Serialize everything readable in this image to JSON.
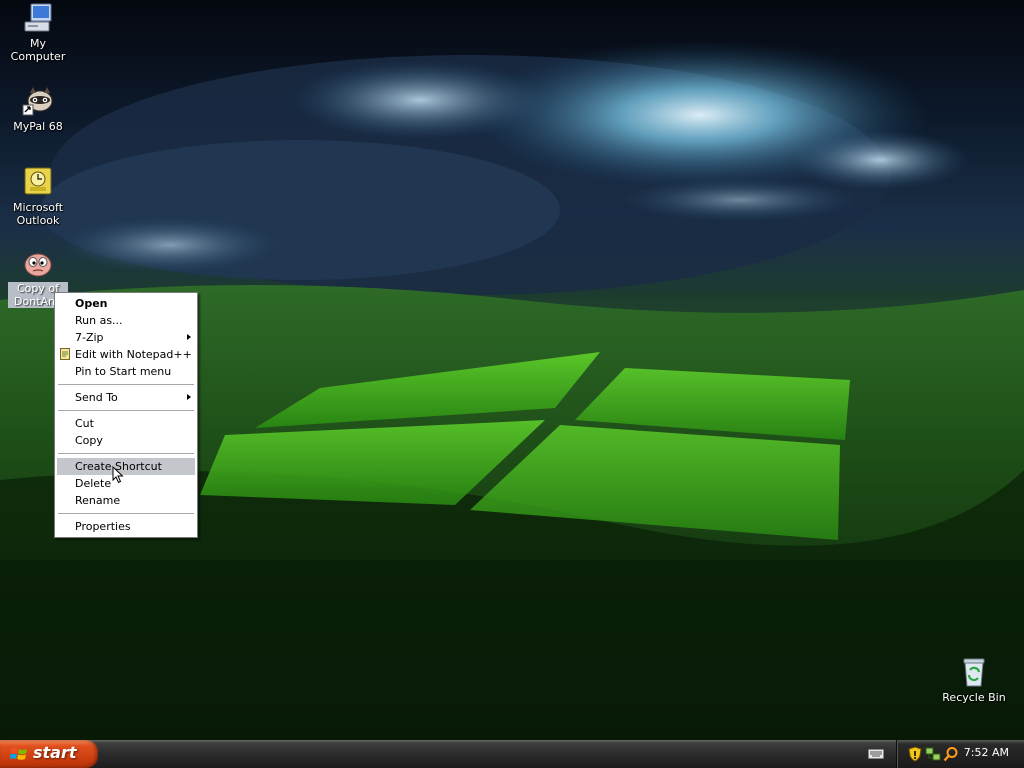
{
  "desktop": {
    "icons": [
      {
        "label": "My Computer",
        "icon": "computer-icon"
      },
      {
        "label": "MyPal 68",
        "icon": "raccoon-browser-icon"
      },
      {
        "label": "Microsoft Outlook",
        "icon": "outlook-icon"
      },
      {
        "label": "Copy of DontAng",
        "icon": "dontang-icon"
      },
      {
        "label": "Recycle Bin",
        "icon": "recycle-bin-icon"
      }
    ]
  },
  "context_menu": {
    "open": "Open",
    "run_as": "Run as...",
    "seven_zip": "7-Zip",
    "edit_notepad": "Edit with Notepad++",
    "pin_start": "Pin to Start menu",
    "send_to": "Send To",
    "cut": "Cut",
    "copy": "Copy",
    "create_shortcut": "Create Shortcut",
    "delete": "Delete",
    "rename": "Rename",
    "properties": "Properties"
  },
  "taskbar": {
    "start_label": "start",
    "clock": "7:52 AM"
  },
  "colors": {
    "start_button": "#d9461a",
    "menu_highlight": "#c3c6cb",
    "taskbar": "#2c2c2c"
  }
}
